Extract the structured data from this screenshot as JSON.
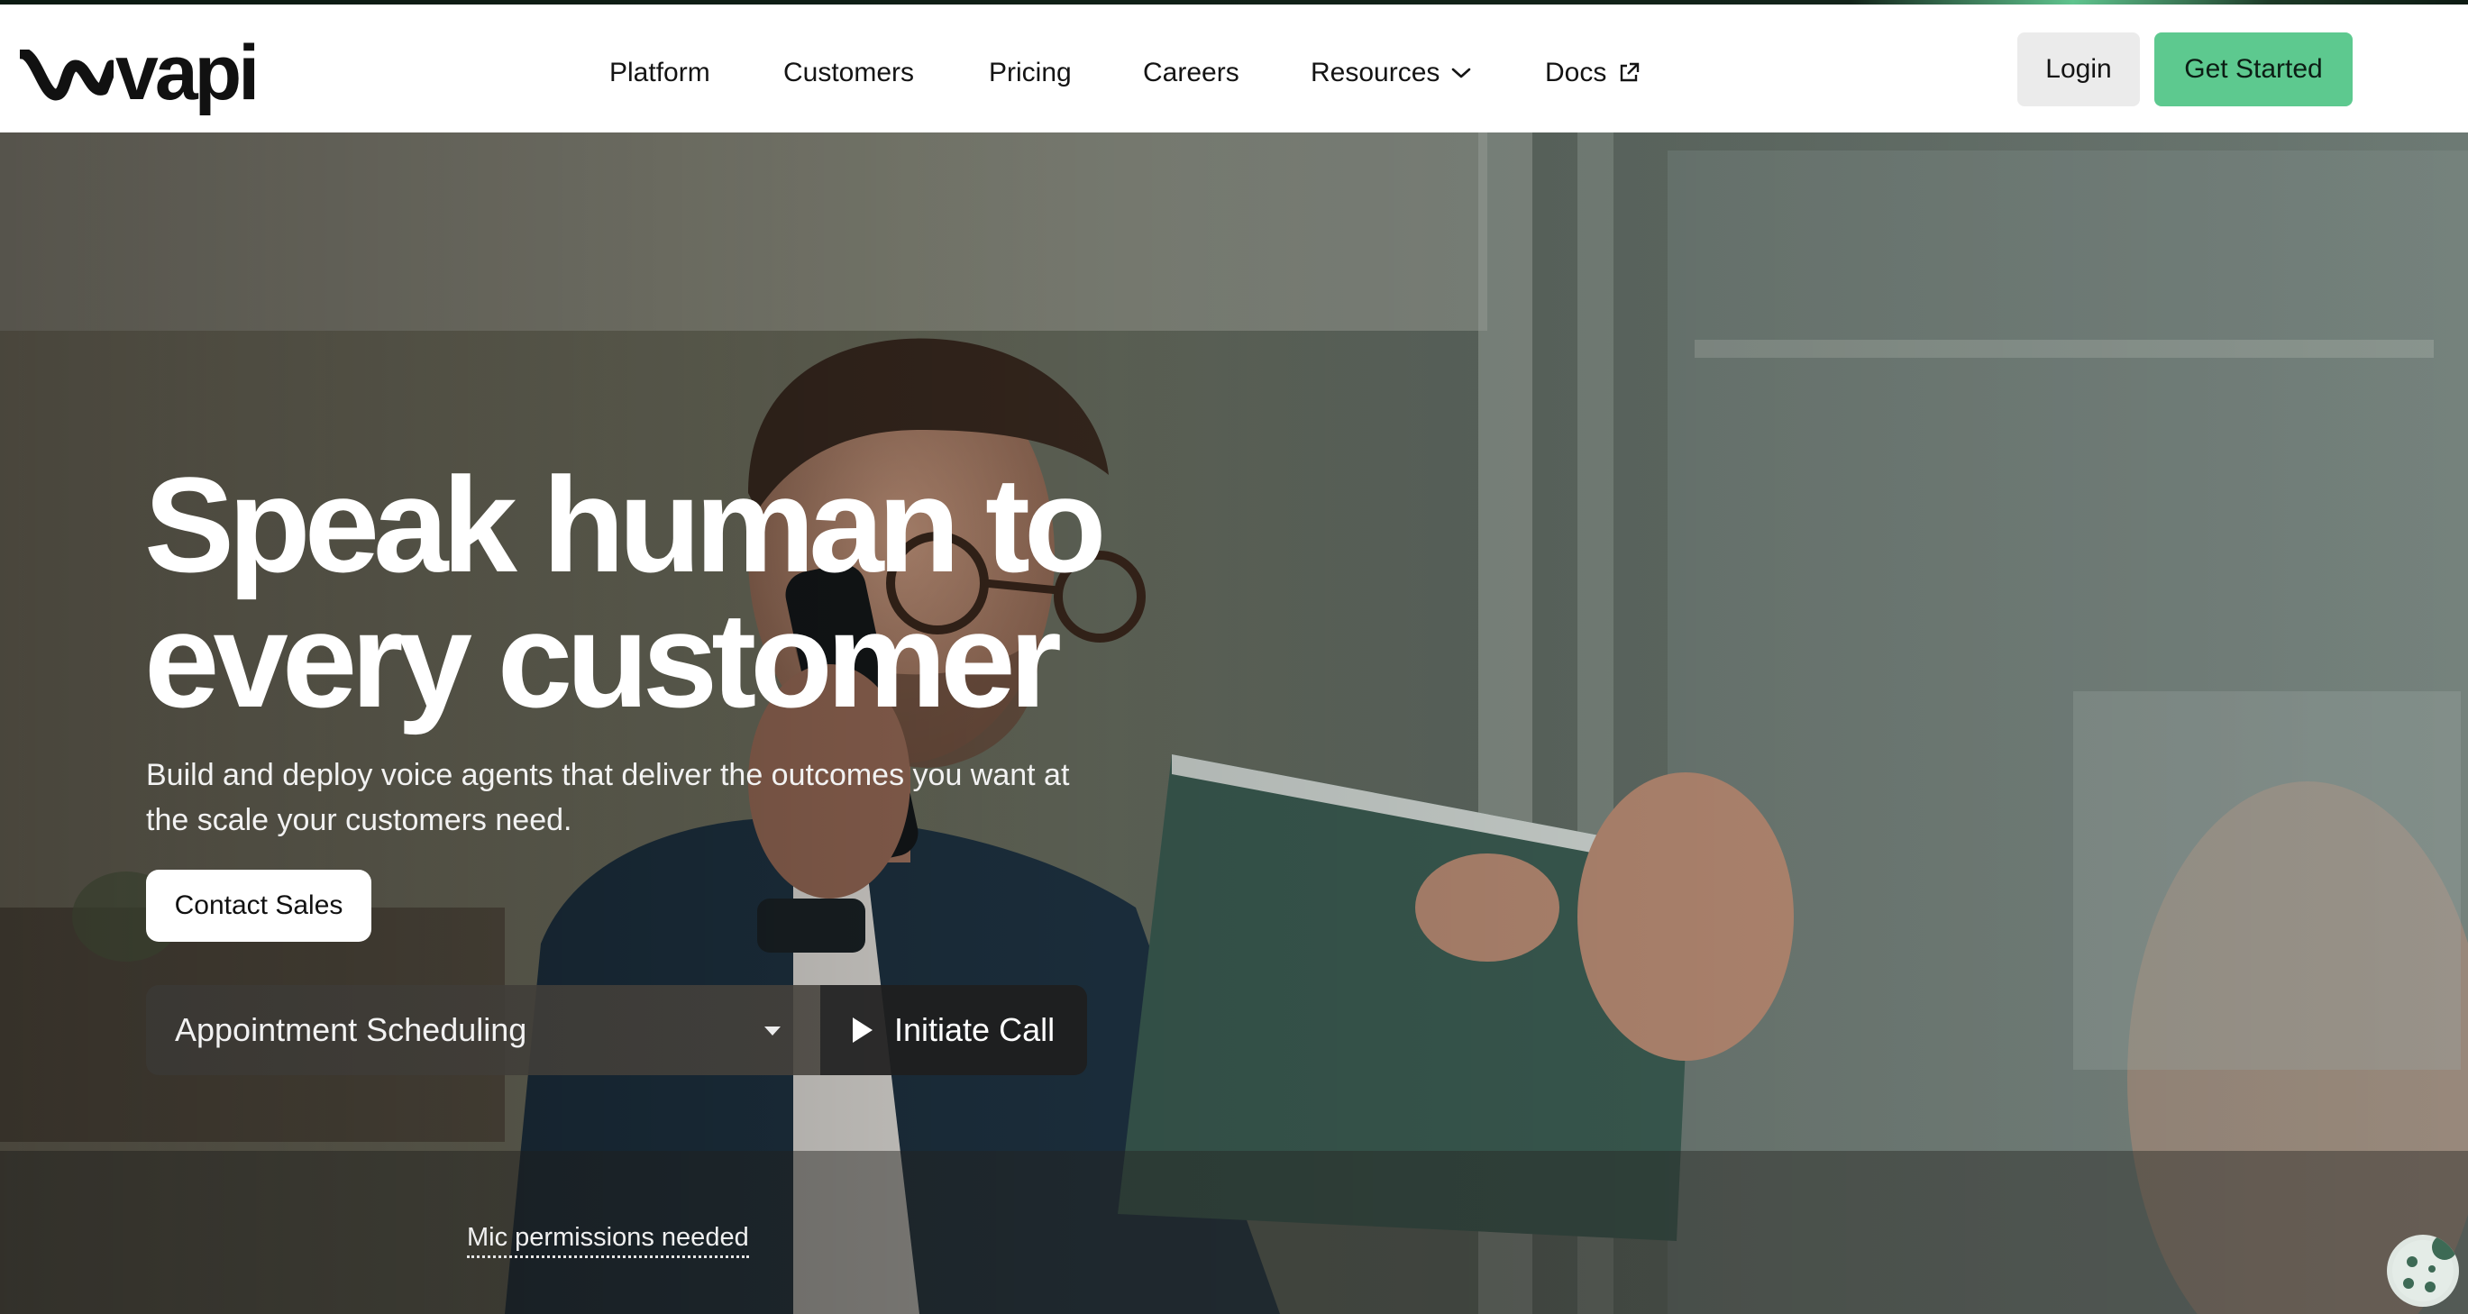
{
  "brand": {
    "name": "vapi",
    "accent": "#5dc98f"
  },
  "nav": {
    "items": [
      {
        "label": "Platform"
      },
      {
        "label": "Customers"
      },
      {
        "label": "Pricing"
      },
      {
        "label": "Careers"
      },
      {
        "label": "Resources",
        "icon": "chevron-down-icon"
      },
      {
        "label": "Docs",
        "icon": "external-link-icon"
      }
    ],
    "login": "Login",
    "get_started": "Get Started"
  },
  "hero": {
    "headline_line1": "Speak human to",
    "headline_line2": "every customer",
    "subtext": "Build and deploy voice agents that deliver the outcomes you want at the scale your customers need.",
    "contact_sales": "Contact Sales",
    "call_widget": {
      "selected_use_case": "Appointment Scheduling",
      "initiate_label": "Initiate Call",
      "mic_note": "Mic permissions needed"
    }
  },
  "cookie": {
    "icon": "cookie-icon"
  }
}
